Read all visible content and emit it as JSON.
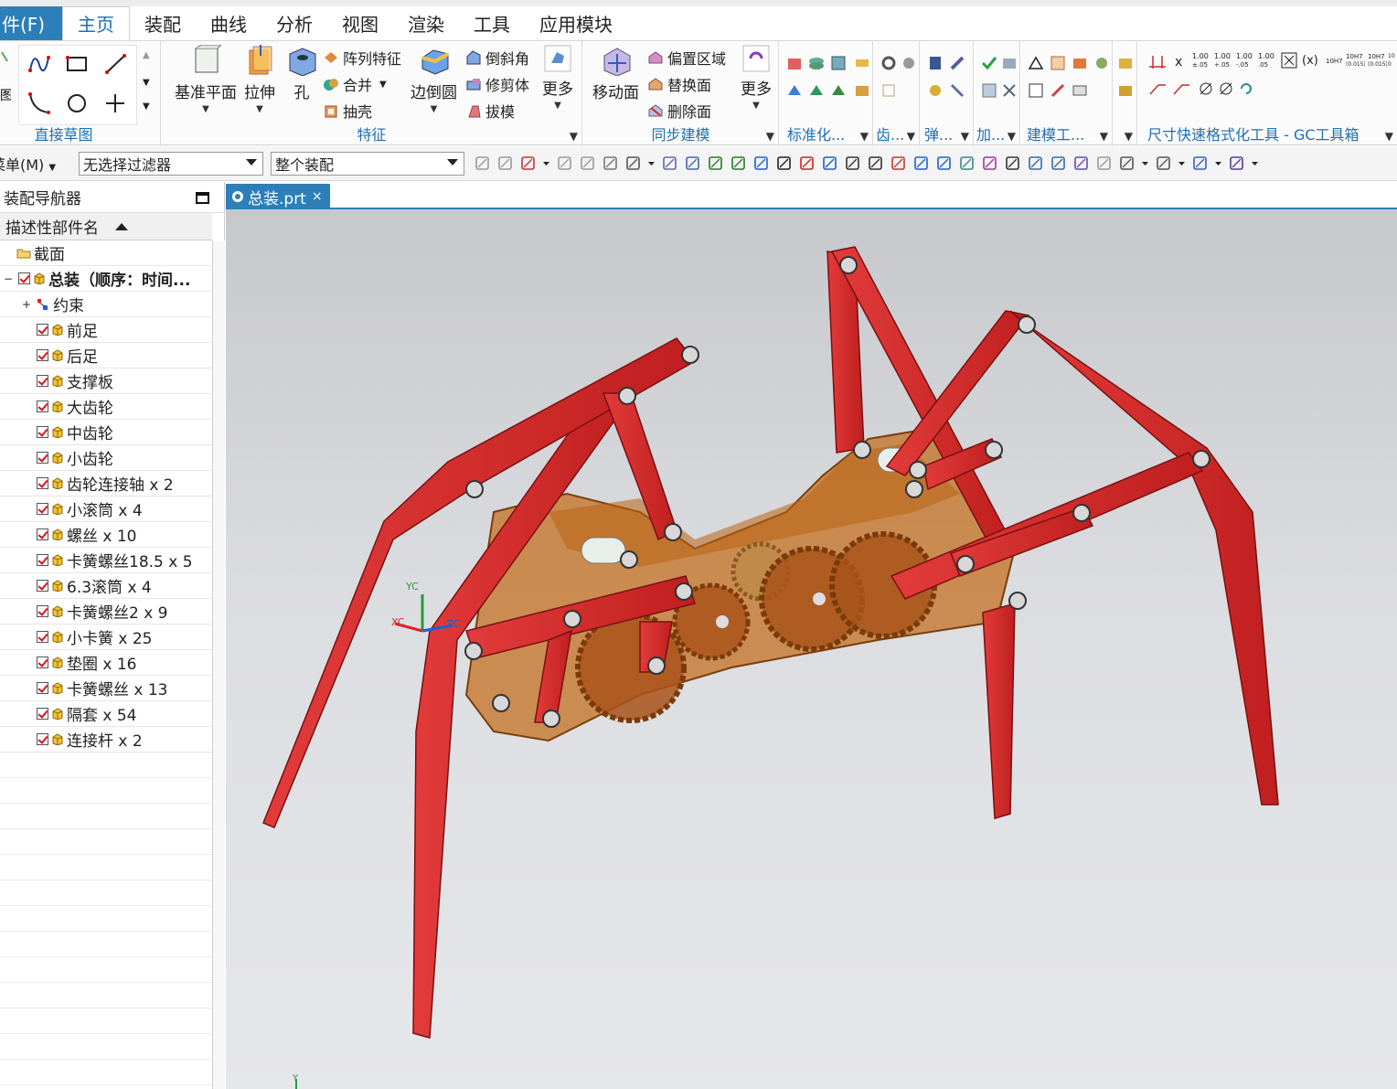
{
  "menubar": {
    "file": "件(F)",
    "tabs": [
      "主页",
      "装配",
      "曲线",
      "分析",
      "视图",
      "渲染",
      "工具",
      "应用模块"
    ],
    "active_tab": "主页"
  },
  "ribbon": {
    "direct_sketch": {
      "label": "直接草图"
    },
    "features": {
      "label": "特征",
      "datum_plane": "基准平面",
      "extrude": "拉伸",
      "hole": "孔",
      "pattern_feature": "阵列特征",
      "unite": "合并",
      "shell": "抽壳",
      "edge_blend": "边倒圆",
      "chamfer": "倒斜角",
      "trim_body": "修剪体",
      "draft": "拔模",
      "more": "更多"
    },
    "sync_modeling": {
      "label": "同步建模",
      "move_face": "移动面",
      "offset_region": "偏置区域",
      "replace_face": "替换面",
      "delete_face": "删除面",
      "more": "更多"
    },
    "standardization": {
      "label": "标准化..."
    },
    "gear": {
      "label": "齿..."
    },
    "spring": {
      "label": "弹..."
    },
    "machining": {
      "label": "加..."
    },
    "modeling_tools": {
      "label": "建模工..."
    },
    "gc_toolkit": {
      "label": "尺寸快速格式化工具 - GC工具箱"
    }
  },
  "toolbar": {
    "menu": "菜单(M)",
    "selection_filter": "无选择过滤器",
    "scope": "整个装配"
  },
  "navigator": {
    "title": "装配导航器",
    "column_header": "描述性部件名",
    "items": [
      {
        "label": "截面",
        "type": "folder"
      },
      {
        "label": "总装（顺序：时间...",
        "type": "root"
      },
      {
        "label": "约束",
        "type": "constraints"
      },
      {
        "label": "前足",
        "type": "part"
      },
      {
        "label": "后足",
        "type": "part"
      },
      {
        "label": "支撑板",
        "type": "part"
      },
      {
        "label": "大齿轮",
        "type": "part"
      },
      {
        "label": "中齿轮",
        "type": "part"
      },
      {
        "label": "小齿轮",
        "type": "part"
      },
      {
        "label": "齿轮连接轴 x 2",
        "type": "part"
      },
      {
        "label": "小滚筒 x 4",
        "type": "part"
      },
      {
        "label": "螺丝 x 10",
        "type": "part"
      },
      {
        "label": "卡簧螺丝18.5 x 5",
        "type": "part"
      },
      {
        "label": "6.3滚筒 x 4",
        "type": "part"
      },
      {
        "label": "卡簧螺丝2 x 9",
        "type": "part"
      },
      {
        "label": "小卡簧 x 25",
        "type": "part"
      },
      {
        "label": "垫圈 x 16",
        "type": "part"
      },
      {
        "label": "卡簧螺丝 x 13",
        "type": "part"
      },
      {
        "label": "隔套 x 54",
        "type": "part"
      },
      {
        "label": "连接杆 x 2",
        "type": "part"
      }
    ]
  },
  "document": {
    "tab": "总装.prt",
    "close": "×"
  },
  "viewport": {
    "axis_labels": {
      "yc": "YC",
      "xc": "XC",
      "zc": "ZC",
      "y": "Y"
    },
    "colors": {
      "legs": "#d42a2a",
      "body": "#b8641a",
      "background": "#dcdde0"
    }
  }
}
